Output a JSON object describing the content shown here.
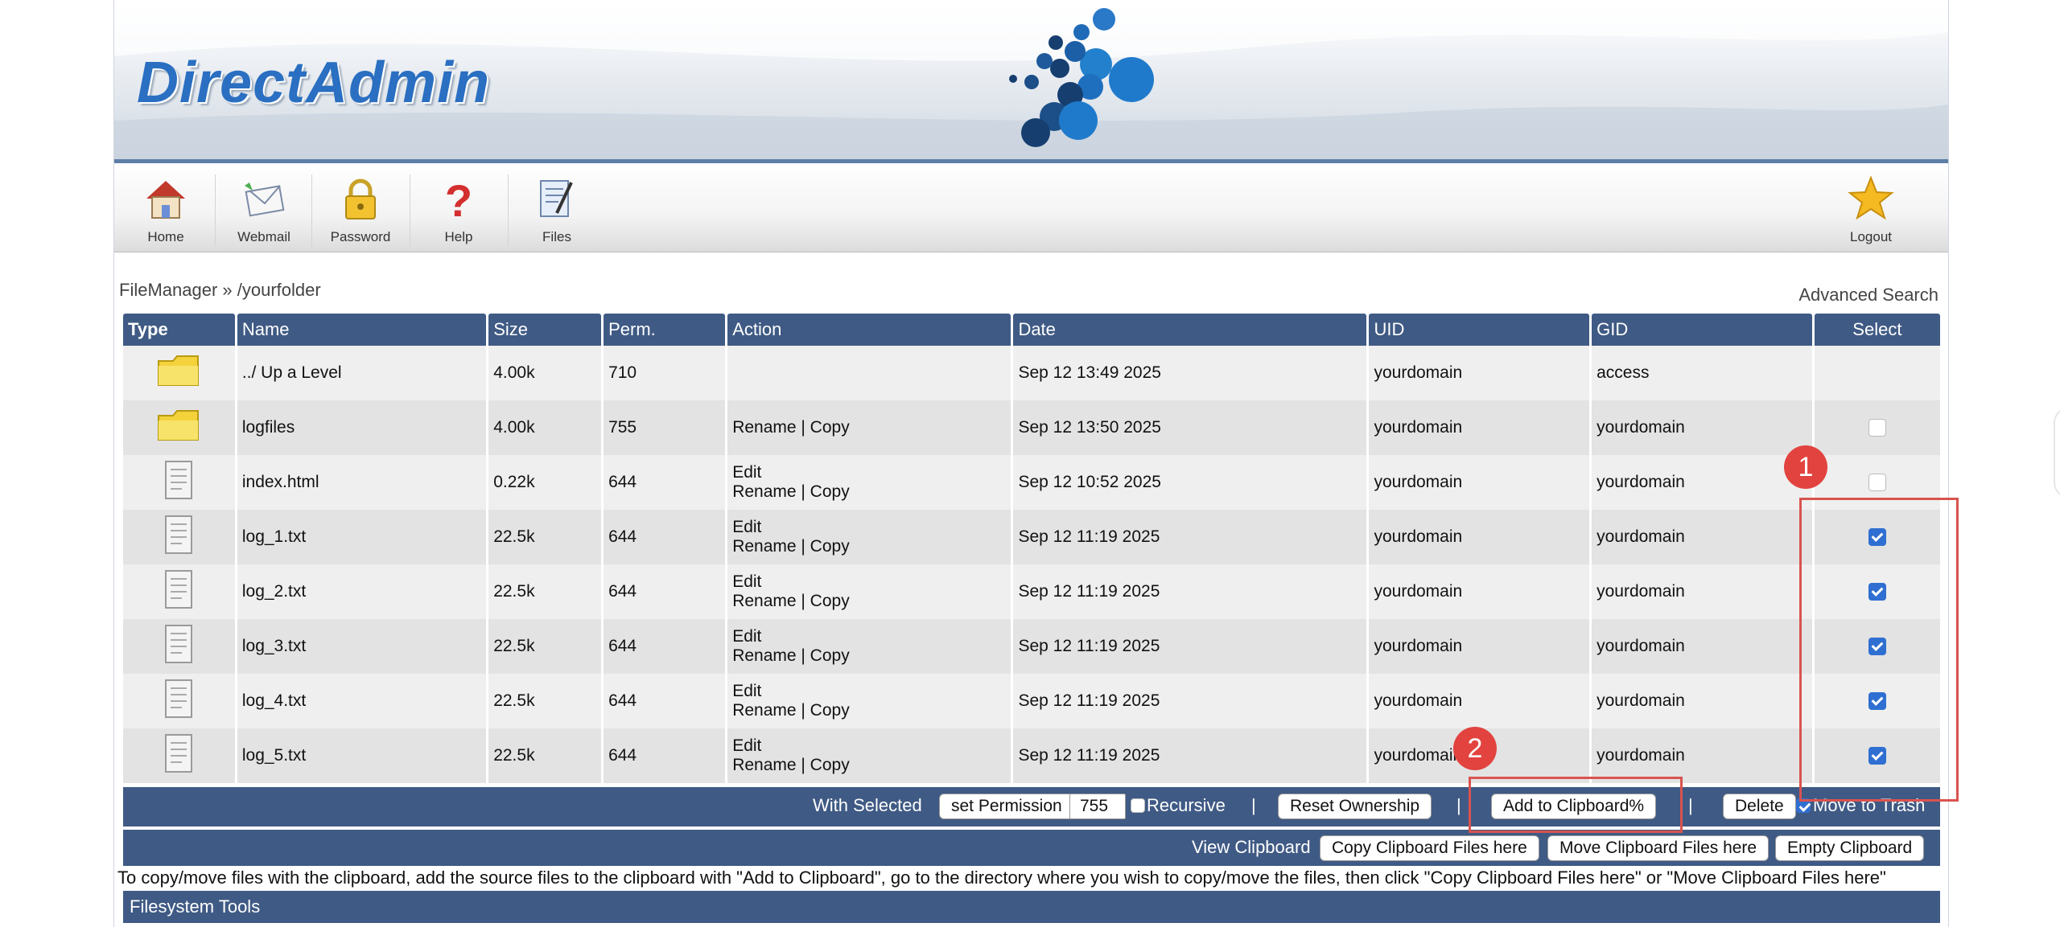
{
  "app": {
    "logo_text": "DirectAdmin"
  },
  "toolbar": [
    {
      "label": "Home",
      "icon": "house-icon"
    },
    {
      "label": "Webmail",
      "icon": "mail-icon"
    },
    {
      "label": "Password",
      "icon": "padlock-icon"
    },
    {
      "label": "Help",
      "icon": "question-icon"
    },
    {
      "label": "Files",
      "icon": "files-icon"
    },
    {
      "label": "Logout",
      "icon": "star-icon"
    }
  ],
  "breadcrumb": "FileManager » /yourfolder",
  "advanced_search": "Advanced Search",
  "table": {
    "headers": [
      "Type",
      "Name",
      "Size",
      "Perm.",
      "Action",
      "Date",
      "UID",
      "GID",
      "Select"
    ],
    "rows": [
      {
        "type": "folder",
        "name": "../ Up a Level",
        "size": "4.00k",
        "perm": "710",
        "action1": "",
        "action2": "",
        "date": "Sep 12 13:49 2025",
        "uid": "yourdomain",
        "gid": "access",
        "select": "none"
      },
      {
        "type": "folder",
        "name": "logfiles",
        "size": "4.00k",
        "perm": "755",
        "action1": "",
        "action2": "Rename | Copy",
        "date": "Sep 12 13:50 2025",
        "uid": "yourdomain",
        "gid": "yourdomain",
        "select": "unchecked"
      },
      {
        "type": "file",
        "name": "index.html",
        "size": "0.22k",
        "perm": "644",
        "action1": "Edit",
        "action2": "Rename | Copy",
        "date": "Sep 12 10:52 2025",
        "uid": "yourdomain",
        "gid": "yourdomain",
        "select": "unchecked"
      },
      {
        "type": "file",
        "name": "log_1.txt",
        "size": "22.5k",
        "perm": "644",
        "action1": "Edit",
        "action2": "Rename | Copy",
        "date": "Sep 12 11:19 2025",
        "uid": "yourdomain",
        "gid": "yourdomain",
        "select": "checked"
      },
      {
        "type": "file",
        "name": "log_2.txt",
        "size": "22.5k",
        "perm": "644",
        "action1": "Edit",
        "action2": "Rename | Copy",
        "date": "Sep 12 11:19 2025",
        "uid": "yourdomain",
        "gid": "yourdomain",
        "select": "checked"
      },
      {
        "type": "file",
        "name": "log_3.txt",
        "size": "22.5k",
        "perm": "644",
        "action1": "Edit",
        "action2": "Rename | Copy",
        "date": "Sep 12 11:19 2025",
        "uid": "yourdomain",
        "gid": "yourdomain",
        "select": "checked"
      },
      {
        "type": "file",
        "name": "log_4.txt",
        "size": "22.5k",
        "perm": "644",
        "action1": "Edit",
        "action2": "Rename | Copy",
        "date": "Sep 12 11:19 2025",
        "uid": "yourdomain",
        "gid": "yourdomain",
        "select": "checked"
      },
      {
        "type": "file",
        "name": "log_5.txt",
        "size": "22.5k",
        "perm": "644",
        "action1": "Edit",
        "action2": "Rename | Copy",
        "date": "Sep 12 11:19 2025",
        "uid": "yourdomain",
        "gid": "yourdomain",
        "select": "checked"
      }
    ]
  },
  "actions": {
    "with_selected": "With Selected",
    "set_permission": "set Permission",
    "permission_value": "755",
    "recursive": "Recursive",
    "sep": "|",
    "reset_ownership": "Reset Ownership",
    "add_to_clipboard": "Add to Clipboard%",
    "delete": "Delete",
    "move_to_trash": "Move to Trash"
  },
  "clipboard": {
    "view": "View Clipboard",
    "copy": "Copy Clipboard Files here",
    "move": "Move Clipboard Files here",
    "empty": "Empty Clipboard"
  },
  "note": "To copy/move files with the clipboard, add the source files to the clipboard with \"Add to Clipboard\", go to the directory where you wish to copy/move the files, then click \"Copy Clipboard Files here\" or \"Move Clipboard Files here\"",
  "filesystem_tools": "Filesystem Tools",
  "annotations": [
    "1",
    "2"
  ],
  "colors": {
    "header_bg": "#3f5a84",
    "accent": "#2f6fd1",
    "annotation": "#e2433f"
  }
}
